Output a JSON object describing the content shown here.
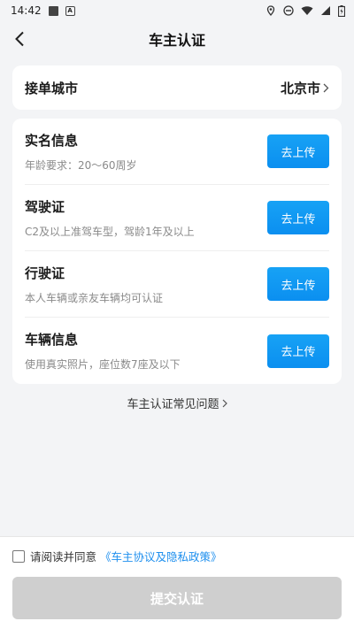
{
  "status_bar": {
    "time": "14:42"
  },
  "nav": {
    "title": "车主认证"
  },
  "city": {
    "label": "接单城市",
    "value": "北京市"
  },
  "items": [
    {
      "title": "实名信息",
      "desc": "年龄要求：20～60周岁",
      "button": "去上传"
    },
    {
      "title": "驾驶证",
      "desc": "C2及以上准驾车型，驾龄1年及以上",
      "button": "去上传"
    },
    {
      "title": "行驶证",
      "desc": "本人车辆或亲友车辆均可认证",
      "button": "去上传"
    },
    {
      "title": "车辆信息",
      "desc": "使用真实照片，座位数7座及以下",
      "button": "去上传"
    }
  ],
  "faq": {
    "label": "车主认证常见问题"
  },
  "footer": {
    "agree_text": "请阅读并同意",
    "agree_link": "《车主协议及隐私政策》",
    "submit_label": "提交认证"
  },
  "colors": {
    "accent": "#0b8ff0",
    "link": "#1e8fee",
    "submit_disabled": "#cfcfcf"
  }
}
